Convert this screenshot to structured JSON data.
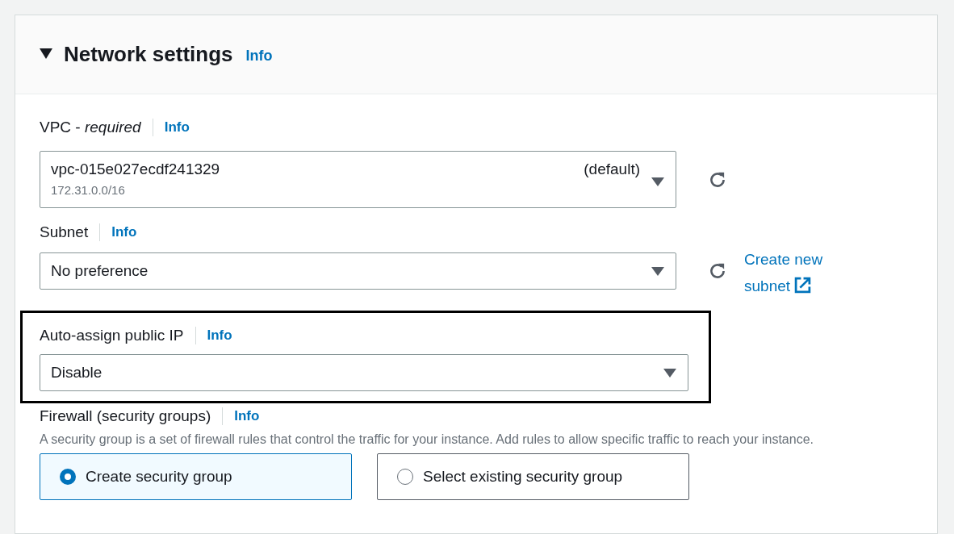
{
  "section": {
    "title": "Network settings",
    "info": "Info",
    "expanded": true
  },
  "fields": [
    {
      "kind": "select",
      "label": "VPC - *required*",
      "info": "Info",
      "value": "vpc-015e027ecdf241329",
      "value_suffix": "(default)",
      "secondary": "172.31.0.0/16",
      "refresh": true,
      "highlighted": false
    },
    {
      "kind": "select",
      "label": "Subnet",
      "info": "Info",
      "value": "No preference",
      "refresh": true,
      "link": "Create new subnet",
      "highlighted": false
    },
    {
      "kind": "select",
      "label": "Auto-assign public IP",
      "info": "Info",
      "value": "Disable",
      "refresh": false,
      "highlighted": true
    },
    {
      "kind": "radio",
      "label": "Firewall (security groups)",
      "info": "Info",
      "description": "A security group is a set of firewall rules that control the traffic for your instance. Add rules to allow specific traffic to reach your instance.",
      "options": [
        {
          "label": "Create security group",
          "selected": true
        },
        {
          "label": "Select existing security group",
          "selected": false
        }
      ]
    }
  ]
}
